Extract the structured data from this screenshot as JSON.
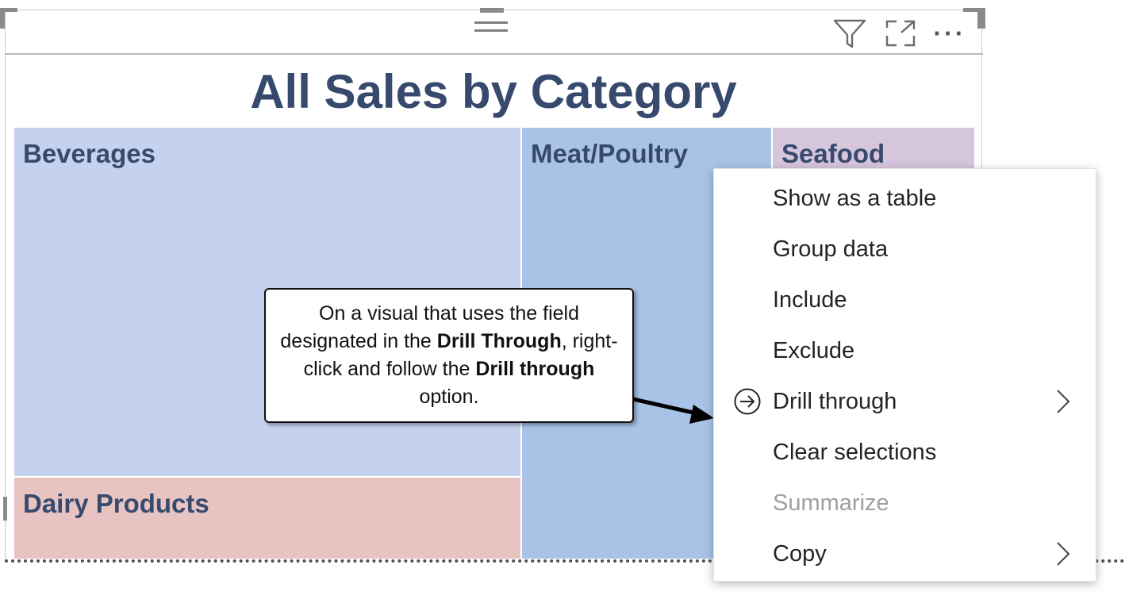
{
  "visual": {
    "title": "All Sales by Category",
    "header_icons": [
      "filter-icon",
      "focus-mode-icon",
      "more-options-icon"
    ],
    "more_label": "···"
  },
  "treemap": {
    "tiles": [
      {
        "label": "Beverages",
        "color": "#c5d2ef"
      },
      {
        "label": "Dairy Products",
        "color": "#e7c3c2"
      },
      {
        "label": "Meat/Poultry",
        "color": "#a9c3e7"
      },
      {
        "label": "Seafood",
        "color": "#d6c6dd"
      }
    ],
    "label_color": "#374a6d"
  },
  "callout": {
    "text_1": "On a visual that uses the field designated in the ",
    "bold_1": "Drill Through",
    "text_2": ", right-click and follow the ",
    "bold_2": "Drill through",
    "text_3": " option."
  },
  "context_menu": {
    "items": [
      {
        "label": "Show as a table"
      },
      {
        "label": "Group data"
      },
      {
        "label": "Include"
      },
      {
        "label": "Exclude"
      },
      {
        "label": "Drill through",
        "icon": "drill-through-icon",
        "submenu": true
      },
      {
        "label": "Clear selections"
      },
      {
        "label": "Summarize",
        "disabled": true
      },
      {
        "label": "Copy",
        "submenu": true
      }
    ]
  }
}
